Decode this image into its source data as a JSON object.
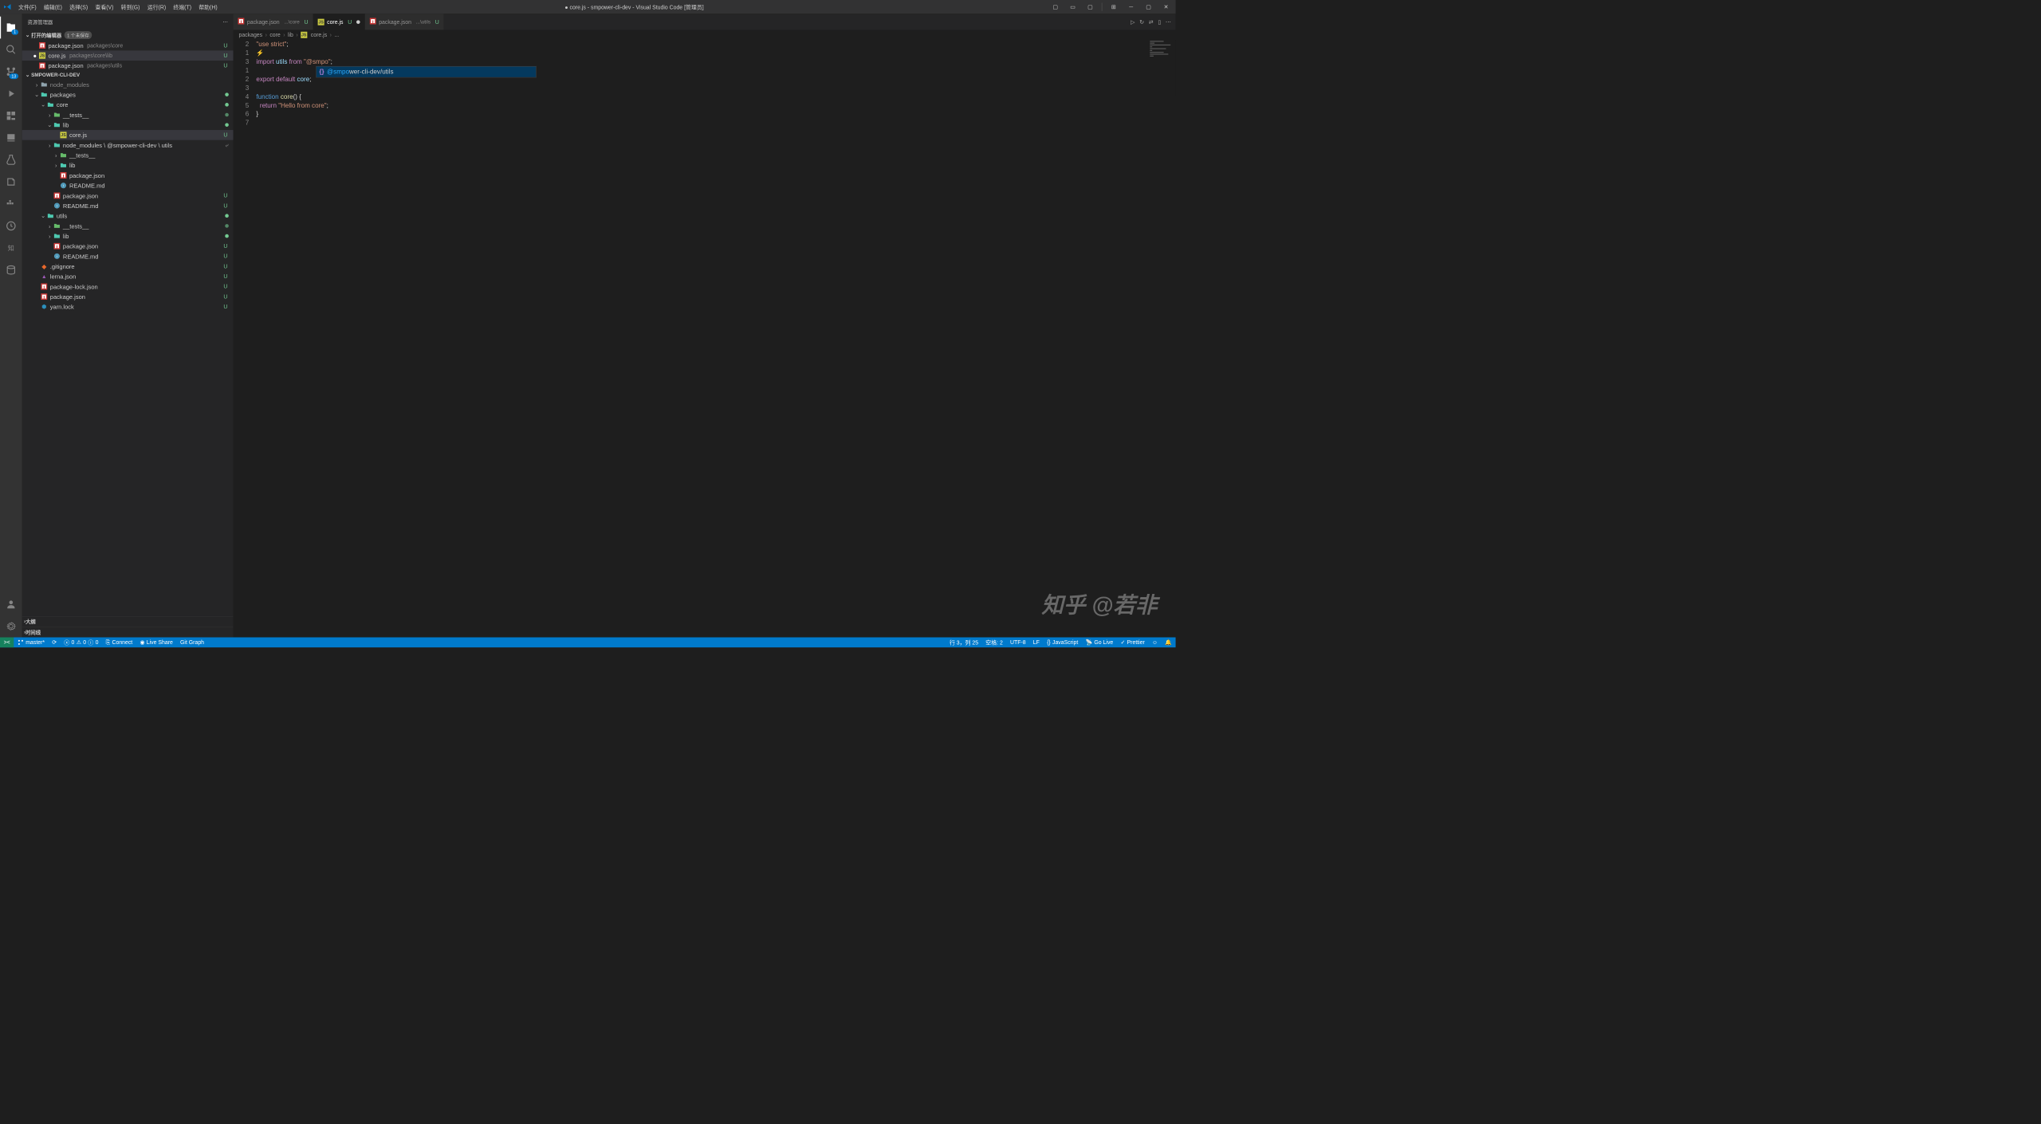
{
  "title": "● core.js - smpower-cli-dev - Visual Studio Code [管理员]",
  "menu": [
    "文件(F)",
    "编辑(E)",
    "选择(S)",
    "查看(V)",
    "转到(G)",
    "运行(R)",
    "终端(T)",
    "帮助(H)"
  ],
  "sidebar": {
    "title": "资源管理器",
    "openEditors": {
      "label": "打开的编辑器",
      "badge": "1 个未保存"
    },
    "editors": [
      {
        "name": "package.json",
        "path": "packages\\core",
        "status": "U"
      },
      {
        "name": "core.js",
        "path": "packages\\core\\lib",
        "status": "U",
        "modified": true
      },
      {
        "name": "package.json",
        "path": "packages\\utils",
        "status": "U"
      }
    ],
    "project": "SMPOWER-CLI-DEV",
    "files": [
      {
        "indent": 1,
        "chev": ">",
        "icon": "folder",
        "label": "node_modules",
        "gray": true
      },
      {
        "indent": 1,
        "chev": "v",
        "icon": "folder-open",
        "label": "packages",
        "dot": true
      },
      {
        "indent": 2,
        "chev": "v",
        "icon": "folder-core",
        "label": "core",
        "dot": true
      },
      {
        "indent": 3,
        "chev": ">",
        "icon": "folder-test",
        "label": "__tests__",
        "dot": true,
        "dimdot": true
      },
      {
        "indent": 3,
        "chev": "v",
        "icon": "folder-lib",
        "label": "lib",
        "dot": true
      },
      {
        "indent": 4,
        "chev": "",
        "icon": "js",
        "label": "core.js",
        "status": "U",
        "active": true
      },
      {
        "indent": 3,
        "chev": ">",
        "icon": "folder-open",
        "label": "node_modules \\ @smpower-cli-dev \\ utils",
        "link": true
      },
      {
        "indent": 4,
        "chev": ">",
        "icon": "folder-test",
        "label": "__tests__"
      },
      {
        "indent": 4,
        "chev": ">",
        "icon": "folder-lib",
        "label": "lib"
      },
      {
        "indent": 4,
        "chev": "",
        "icon": "npm",
        "label": "package.json"
      },
      {
        "indent": 4,
        "chev": "",
        "icon": "md",
        "label": "README.md"
      },
      {
        "indent": 3,
        "chev": "",
        "icon": "npm",
        "label": "package.json",
        "status": "U"
      },
      {
        "indent": 3,
        "chev": "",
        "icon": "md",
        "label": "README.md",
        "status": "U"
      },
      {
        "indent": 2,
        "chev": "v",
        "icon": "folder-utils",
        "label": "utils",
        "dot": true
      },
      {
        "indent": 3,
        "chev": ">",
        "icon": "folder-test",
        "label": "__tests__",
        "dot": true,
        "dimdot": true
      },
      {
        "indent": 3,
        "chev": ">",
        "icon": "folder-lib",
        "label": "lib",
        "dot": true
      },
      {
        "indent": 3,
        "chev": "",
        "icon": "npm",
        "label": "package.json",
        "status": "U"
      },
      {
        "indent": 3,
        "chev": "",
        "icon": "md",
        "label": "README.md",
        "status": "U"
      },
      {
        "indent": 1,
        "chev": "",
        "icon": "git",
        "label": ".gitignore",
        "status": "U"
      },
      {
        "indent": 1,
        "chev": "",
        "icon": "lerna",
        "label": "lerna.json",
        "status": "U"
      },
      {
        "indent": 1,
        "chev": "",
        "icon": "npm",
        "label": "package-lock.json",
        "status": "U"
      },
      {
        "indent": 1,
        "chev": "",
        "icon": "npm",
        "label": "package.json",
        "status": "U"
      },
      {
        "indent": 1,
        "chev": "",
        "icon": "yarn",
        "label": "yarn.lock",
        "status": "U"
      }
    ],
    "outline": "大纲",
    "timeline": "时间线"
  },
  "activity": {
    "scmBadge": "13",
    "explorerBadge": "1"
  },
  "tabs": [
    {
      "icon": "npm",
      "label": "package.json",
      "sub": "...\\core",
      "status": "U"
    },
    {
      "icon": "js",
      "label": "core.js",
      "status": "U",
      "modified": true,
      "active": true
    },
    {
      "icon": "npm",
      "label": "package.json",
      "sub": "...\\utils",
      "status": "U"
    }
  ],
  "breadcrumb": [
    "packages",
    "core",
    "lib",
    "core.js",
    "..."
  ],
  "code": {
    "gutter": [
      "2",
      "1",
      "3",
      "1",
      "2",
      "3",
      "4",
      "5",
      "6",
      "7"
    ],
    "lines": [
      [
        [
          "tok-str",
          "\"use strict\""
        ],
        [
          "tok-plain",
          ";"
        ]
      ],
      [
        [
          "tok-def",
          "⚡"
        ]
      ],
      [
        [
          "tok-kw",
          "import"
        ],
        [
          "tok-plain",
          " "
        ],
        [
          "tok-id",
          "utils"
        ],
        [
          "tok-plain",
          " "
        ],
        [
          "tok-kw",
          "from"
        ],
        [
          "tok-plain",
          " "
        ],
        [
          "tok-str",
          "\"@smpo\""
        ],
        [
          "tok-plain",
          ";"
        ]
      ],
      [],
      [
        [
          "tok-kw",
          "export"
        ],
        [
          "tok-plain",
          " "
        ],
        [
          "tok-kw",
          "default"
        ],
        [
          "tok-plain",
          " "
        ],
        [
          "tok-id",
          "core"
        ],
        [
          "tok-plain",
          ";"
        ]
      ],
      [],
      [
        [
          "tok-def",
          "function"
        ],
        [
          "tok-plain",
          " "
        ],
        [
          "tok-fn",
          "core"
        ],
        [
          "tok-plain",
          "() {"
        ]
      ],
      [
        [
          "tok-plain",
          "  "
        ],
        [
          "tok-kw",
          "return"
        ],
        [
          "tok-plain",
          " "
        ],
        [
          "tok-str",
          "\"Hello from core\""
        ],
        [
          "tok-plain",
          ";"
        ]
      ],
      [
        [
          "tok-plain",
          "}"
        ]
      ],
      []
    ],
    "suggest": {
      "icon": "{}",
      "prefix": "@smpo",
      "rest": "wer-cli-dev/utils"
    }
  },
  "status": {
    "remote": "><",
    "branch": "master*",
    "sync": "⟳",
    "problems": {
      "err": "0",
      "warn": "0",
      "info": "0"
    },
    "connect": "Connect",
    "liveshare": "Live Share",
    "gitgraph": "Git Graph",
    "position": "行 3，列 25",
    "spaces": "空格: 2",
    "encoding": "UTF-8",
    "eol": "LF",
    "lang": "JavaScript",
    "golive": "Go Live",
    "prettier": "Prettier",
    "bell": "🔔"
  },
  "watermark": "知乎 @若非",
  "iconColors": {
    "js": "#cbcb41",
    "npm": "#cb3837",
    "md": "#519aba",
    "git": "#e8682c",
    "yarn": "#2c8ebb",
    "lerna": "#9b59b6",
    "folder": "#90a4ae",
    "folder-open": "#4ec9b0",
    "folder-core": "#4ec9b0",
    "folder-test": "#66bb6a",
    "folder-lib": "#4ec9b0",
    "folder-utils": "#4ec9b0"
  }
}
